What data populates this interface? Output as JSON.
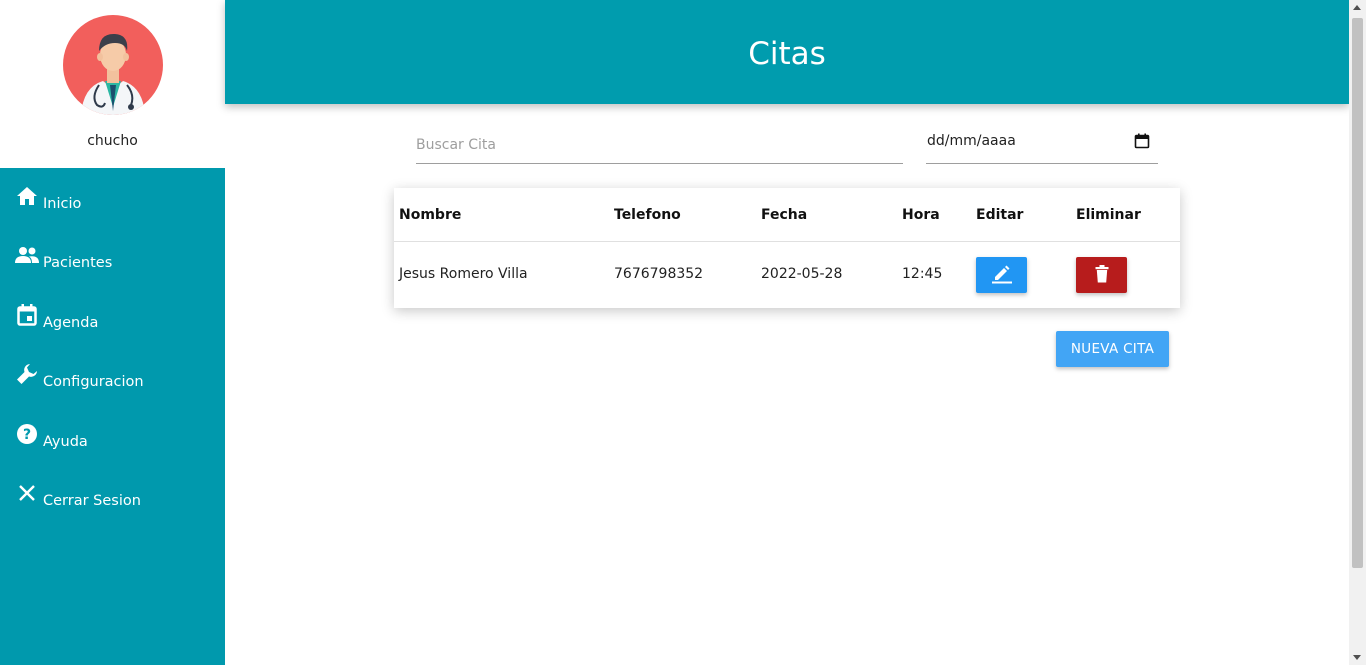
{
  "colors": {
    "sidebar": "#0099ad",
    "header": "#009cae",
    "edit_button": "#2196f3",
    "delete_button": "#b71c1c",
    "new_button": "#42a5f5",
    "avatar_bg": "#f25f5c"
  },
  "sidebar": {
    "username": "chucho",
    "avatar_icon": "doctor-avatar",
    "items": [
      {
        "label": "Inicio",
        "icon": "home-icon"
      },
      {
        "label": "Pacientes",
        "icon": "people-icon"
      },
      {
        "label": "Agenda",
        "icon": "calendar-icon"
      },
      {
        "label": "Configuracion",
        "icon": "wrench-icon"
      },
      {
        "label": "Ayuda",
        "icon": "help-icon"
      },
      {
        "label": "Cerrar Sesion",
        "icon": "close-icon"
      }
    ]
  },
  "header": {
    "title": "Citas"
  },
  "search": {
    "placeholder": "Buscar Cita",
    "value": ""
  },
  "date_filter": {
    "placeholder": "dd/mm/aaaa"
  },
  "table": {
    "columns": [
      "Nombre",
      "Telefono",
      "Fecha",
      "Hora",
      "Editar",
      "Eliminar"
    ],
    "rows": [
      {
        "nombre": "Jesus Romero Villa",
        "telefono": "7676798352",
        "fecha": "2022-05-28",
        "hora": "12:45"
      }
    ]
  },
  "actions": {
    "new_label": "NUEVA CITA"
  }
}
